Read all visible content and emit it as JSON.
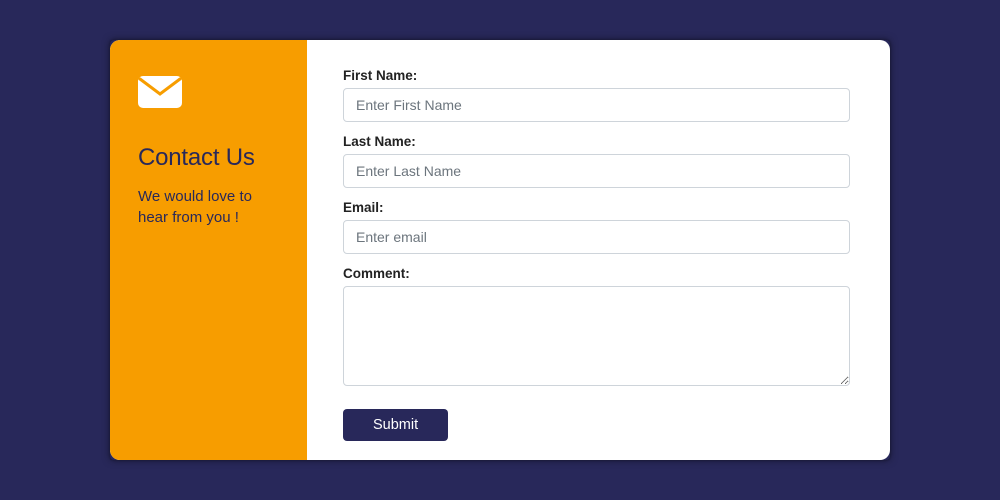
{
  "sidebar": {
    "title": "Contact Us",
    "description": "We would love to hear from you !"
  },
  "form": {
    "firstName": {
      "label": "First Name:",
      "placeholder": "Enter First Name",
      "value": ""
    },
    "lastName": {
      "label": "Last Name:",
      "placeholder": "Enter Last Name",
      "value": ""
    },
    "email": {
      "label": "Email:",
      "placeholder": "Enter email",
      "value": ""
    },
    "comment": {
      "label": "Comment:",
      "placeholder": "",
      "value": ""
    },
    "submitLabel": "Submit"
  },
  "colors": {
    "accent": "#f79d00",
    "dark": "#28285a"
  }
}
